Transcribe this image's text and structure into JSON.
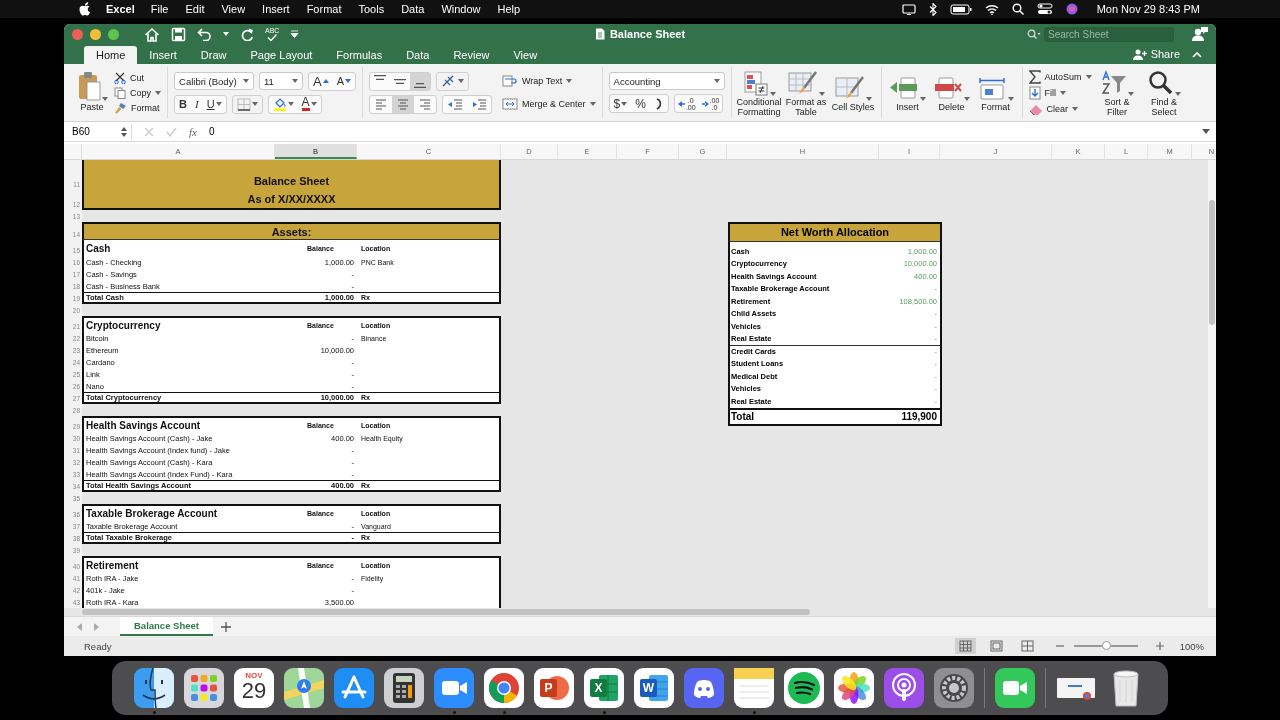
{
  "menu_bar": {
    "app": "Excel",
    "items": [
      "File",
      "Edit",
      "View",
      "Insert",
      "Format",
      "Tools",
      "Data",
      "Window",
      "Help"
    ],
    "clock": "Mon Nov 29  8:43 PM"
  },
  "window": {
    "title": "Balance Sheet",
    "spelling": "ABC",
    "search": {
      "placeholder": "Search Sheet"
    },
    "share": "Share"
  },
  "tabs": [
    {
      "label": "Home",
      "selected": true
    },
    {
      "label": "Insert",
      "selected": false
    },
    {
      "label": "Draw",
      "selected": false
    },
    {
      "label": "Page Layout",
      "selected": false
    },
    {
      "label": "Formulas",
      "selected": false
    },
    {
      "label": "Data",
      "selected": false
    },
    {
      "label": "Review",
      "selected": false
    },
    {
      "label": "View",
      "selected": false
    }
  ],
  "ribbon": {
    "clipboard": {
      "paste": "Paste",
      "cut": "Cut",
      "copy": "Copy",
      "format": "Format"
    },
    "font": {
      "name": "Calibri (Body)",
      "size": "11",
      "grow": "A",
      "shrink": "A",
      "bold": "B",
      "italic": "I",
      "underline": "U",
      "font_color": "A"
    },
    "alignment": {
      "vertical": [
        {
          "selected": false
        },
        {
          "selected": false
        },
        {
          "selected": true
        }
      ],
      "horizontal": [
        {
          "selected": false
        },
        {
          "selected": true
        },
        {
          "selected": false
        }
      ],
      "wrap": "Wrap Text",
      "merge": "Merge & Center"
    },
    "number": {
      "format": "Accounting",
      "currency": "$",
      "percent": "%",
      "increase_decimal": [
        ".0",
        ".00"
      ],
      "decrease_decimal": [
        ".00",
        ".0"
      ]
    },
    "styles": [
      "Conditional Formatting",
      "Format as Table",
      "Cell Styles"
    ],
    "cells": [
      "Insert",
      "Delete",
      "Format"
    ],
    "editing": {
      "autosum": "AutoSum",
      "fill": "Fill",
      "clear": "Clear",
      "sort": "Sort & Filter",
      "find": "Find & Select"
    }
  },
  "formula_bar": {
    "name_box": "B60",
    "function": "fx",
    "value": "0"
  },
  "sheet": {
    "columns": [
      {
        "label": "A",
        "selected": false
      },
      {
        "label": "B",
        "selected": true
      },
      {
        "label": "C",
        "selected": false
      },
      {
        "label": "D",
        "selected": false
      },
      {
        "label": "E",
        "selected": false
      },
      {
        "label": "F",
        "selected": false
      },
      {
        "label": "G",
        "selected": false
      },
      {
        "label": "H",
        "selected": false
      },
      {
        "label": "I",
        "selected": false
      },
      {
        "label": "J",
        "selected": false
      },
      {
        "label": "K",
        "selected": false
      },
      {
        "label": "L",
        "selected": false
      },
      {
        "label": "M",
        "selected": false
      },
      {
        "label": "N",
        "selected": false
      }
    ],
    "blocks": [
      {
        "kind": "title",
        "rows": [
          {
            "num": "11",
            "text": "Balance Sheet"
          },
          {
            "num": "12",
            "text": "As of X/XX/XXXX"
          }
        ]
      },
      {
        "kind": "spacer",
        "num": "13"
      },
      {
        "kind": "table",
        "band": {
          "num": "14",
          "text": "Assets:"
        },
        "header": {
          "num": "15",
          "title": "Cash",
          "balance": "Balance",
          "location": "Location"
        },
        "items": [
          {
            "num": "16",
            "label": "Cash - Checking",
            "balance": "1,000.00",
            "location": "PNC Bank"
          },
          {
            "num": "17",
            "label": "Cash - Savings",
            "balance": "-"
          },
          {
            "num": "18",
            "label": "Cash - Business Bank",
            "balance": "-"
          }
        ],
        "total": {
          "num": "19",
          "label": "Total Cash",
          "balance": "1,000.00",
          "location": "Rx"
        }
      },
      {
        "kind": "spacer",
        "num": "20"
      },
      {
        "kind": "table",
        "header": {
          "num": "21",
          "title": "Cryptocurrency",
          "balance": "Balance",
          "location": "Location"
        },
        "items": [
          {
            "num": "22",
            "label": "Bitcoin",
            "balance": "-",
            "location": "Binance"
          },
          {
            "num": "23",
            "label": "Ethereum",
            "balance": "10,000.00"
          },
          {
            "num": "24",
            "label": "Cardano",
            "balance": "-"
          },
          {
            "num": "25",
            "label": "Link",
            "balance": "-"
          },
          {
            "num": "26",
            "label": "Nano",
            "balance": "-"
          }
        ],
        "total": {
          "num": "27",
          "label": "Total Cryptocurrency",
          "balance": "10,000.00",
          "location": "Rx"
        }
      },
      {
        "kind": "spacer",
        "num": "28"
      },
      {
        "kind": "table",
        "header": {
          "num": "29",
          "title": "Health Savings Account",
          "balance": "Balance",
          "location": "Location"
        },
        "items": [
          {
            "num": "30",
            "label": "Health Savings Account (Cash) - Jake",
            "balance": "400.00",
            "location": "Health Equity"
          },
          {
            "num": "31",
            "label": "Health Savings Account (Index fund) - Jake",
            "balance": "-"
          },
          {
            "num": "32",
            "label": "Health Savings Account (Cash) - Kara",
            "balance": "-"
          },
          {
            "num": "33",
            "label": "Health Savings Account (Index Fund) - Kara",
            "balance": "-"
          }
        ],
        "total": {
          "num": "34",
          "label": "Total Health Savings Account",
          "balance": "400.00",
          "location": "Rx"
        }
      },
      {
        "kind": "spacer",
        "num": "35"
      },
      {
        "kind": "table",
        "header": {
          "num": "36",
          "title": "Taxable Brokerage Account",
          "balance": "Balance",
          "location": "Location"
        },
        "items": [
          {
            "num": "37",
            "label": "Taxable Brokerage Account",
            "balance": "-",
            "location": "Vanguard"
          }
        ],
        "total": {
          "num": "38",
          "label": "Total Taxable Brokerage",
          "balance": "-",
          "location": "Rx"
        }
      },
      {
        "kind": "spacer",
        "num": "39"
      },
      {
        "kind": "table",
        "header": {
          "num": "40",
          "title": "Retirement",
          "balance": "Balance",
          "location": "Location"
        },
        "items": [
          {
            "num": "41",
            "label": "Roth IRA - Jake",
            "balance": "-",
            "location": "Fidelity"
          },
          {
            "num": "42",
            "label": "401k - Jake",
            "balance": "-"
          },
          {
            "num": "43",
            "label": "Roth IRA - Kara",
            "balance": "3,500.00"
          }
        ]
      }
    ],
    "net_worth": {
      "title": "Net Worth Allocation",
      "items": [
        {
          "label": "Cash",
          "value": "1,000.00",
          "kind": "asset"
        },
        {
          "label": "Cryptocurrency",
          "value": "10,000.00",
          "kind": "asset"
        },
        {
          "label": "Health Savings Account",
          "value": "400.00",
          "kind": "asset"
        },
        {
          "label": "Taxable Brokerage Account",
          "value": "-",
          "kind": "asset"
        },
        {
          "label": "Retirement",
          "value": "108,500.00",
          "kind": "asset"
        },
        {
          "label": "Child Assets",
          "value": "-",
          "kind": "asset"
        },
        {
          "label": "Vehicles",
          "value": "-",
          "kind": "asset"
        },
        {
          "label": "Real Estate",
          "value": "-",
          "kind": "asset"
        },
        {
          "label": "Credit Cards",
          "value": "-",
          "kind": "liability"
        },
        {
          "label": "Student Loans",
          "value": "-",
          "kind": "liability"
        },
        {
          "label": "Medical Debt",
          "value": "-",
          "kind": "liability"
        },
        {
          "label": "Vehicles",
          "value": "-",
          "kind": "liability"
        },
        {
          "label": "Real Estate",
          "value": "-",
          "kind": "liability"
        }
      ],
      "total": {
        "label": "Total",
        "value": "119,900"
      }
    }
  },
  "sheet_tabs": [
    {
      "label": "Balance Sheet",
      "selected": true
    }
  ],
  "status_bar": {
    "status": "Ready",
    "views": [
      {
        "selected": true
      },
      {
        "selected": false
      },
      {
        "selected": false
      }
    ],
    "zoom": {
      "level": 0.5,
      "reading": "100%"
    }
  },
  "dock": [
    {
      "kind": "finder",
      "running": true
    },
    {
      "kind": "launchpad",
      "running": false
    },
    {
      "kind": "calendar",
      "month": "NOV",
      "day": "29",
      "running": false
    },
    {
      "kind": "maps",
      "running": false
    },
    {
      "kind": "appstore",
      "running": false
    },
    {
      "kind": "calculator",
      "running": false
    },
    {
      "kind": "zoom",
      "running": true
    },
    {
      "kind": "chrome",
      "running": true
    },
    {
      "kind": "powerpoint",
      "letter": "P",
      "running": false
    },
    {
      "kind": "excel",
      "letter": "X",
      "running": true
    },
    {
      "kind": "word",
      "letter": "W",
      "running": false
    },
    {
      "kind": "discord",
      "running": false
    },
    {
      "kind": "notes",
      "running": true
    },
    {
      "kind": "spotify",
      "running": false
    },
    {
      "kind": "photos",
      "running": false
    },
    {
      "kind": "podcasts",
      "running": false
    },
    {
      "kind": "settings",
      "running": false
    },
    {
      "kind": "separator"
    },
    {
      "kind": "facetime",
      "running": false
    },
    {
      "kind": "separator"
    },
    {
      "kind": "window",
      "running": false
    },
    {
      "kind": "trash",
      "running": false
    }
  ]
}
